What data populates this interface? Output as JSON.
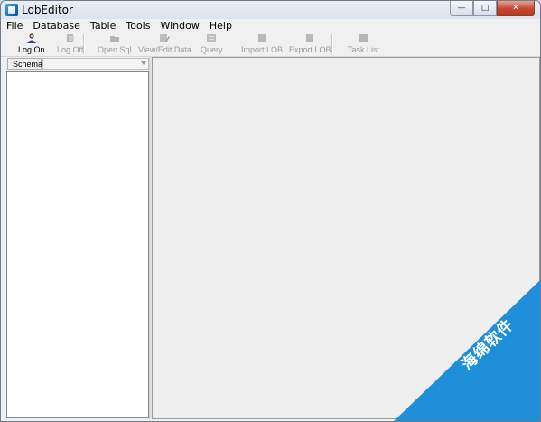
{
  "window": {
    "title": "LobEditor"
  },
  "title_buttons": {
    "minimize": "—",
    "maximize": "□",
    "close": "✕"
  },
  "menu": [
    "File",
    "Database",
    "Table",
    "Tools",
    "Window",
    "Help"
  ],
  "toolbar": {
    "log_on": "Log On",
    "log_off": "Log Off",
    "open_sql": "Open Sql",
    "view_edit_data": "View/Edit Data",
    "query": "Query",
    "import_lob": "Import LOB",
    "export_lob": "Export LOB",
    "task_list": "Task List"
  },
  "schema": {
    "label": "Schema",
    "value": ""
  },
  "watermark": {
    "text": "海绵软件"
  },
  "colors": {
    "watermark_blue": "#1e8fd8",
    "window_frame": "#dbe4ef"
  }
}
